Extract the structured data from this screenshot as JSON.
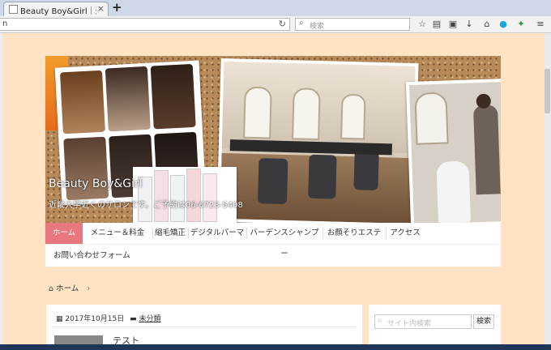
{
  "browser": {
    "tab_title": "Beauty Boy&Girl｜近畿大学",
    "tab_close": "×",
    "new_tab": "+",
    "url_text": "n",
    "reload": "↻",
    "search_placeholder": "検索",
    "toolbar_icons": [
      "star-icon",
      "clipboard-icon",
      "lock-icon",
      "download-icon",
      "home-icon",
      "skype-icon",
      "tools-icon",
      "menu-icon"
    ]
  },
  "site": {
    "title": "Beauty Boy&Girl",
    "description": "近畿大学近くのサロンです。ご予約は06-6723-5408"
  },
  "nav": {
    "items": [
      "ホーム",
      "メニュー＆料金",
      "縮毛矯正",
      "デジタルパーマ",
      "バーデンスシャンプー",
      "お顔そりエステ",
      "アクセス"
    ],
    "second_row": "お問い合わせフォーム"
  },
  "breadcrumb": {
    "home": "ホーム",
    "separator": "›"
  },
  "post": {
    "date": "2017年10月15日",
    "category": "未分類",
    "title": "テスト"
  },
  "sidebar": {
    "search_placeholder": "サイト内検索",
    "search_button": "検索"
  },
  "colors": {
    "page_background": "#ffe3c4",
    "nav_active": "#e8787d"
  }
}
